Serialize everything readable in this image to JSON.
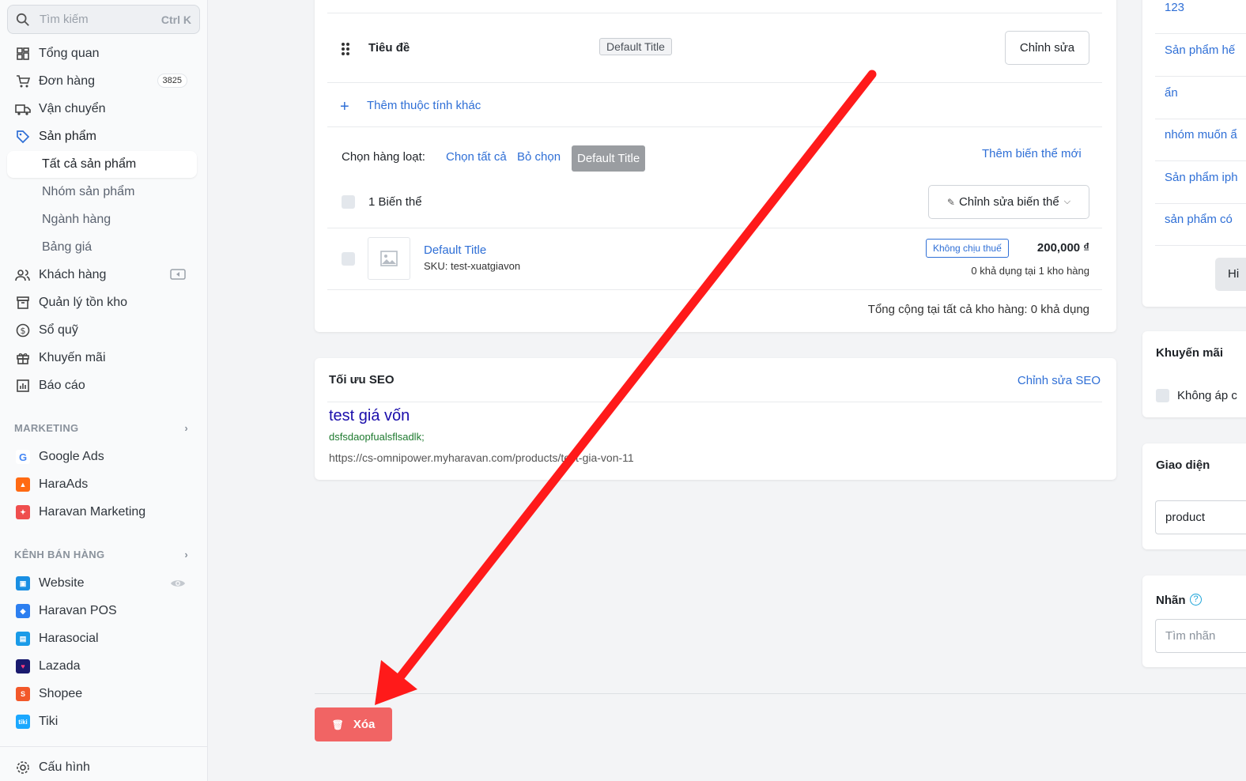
{
  "sidebar": {
    "search": {
      "placeholder": "Tìm kiếm",
      "shortcut": "Ctrl K"
    },
    "items": {
      "overview": "Tổng quan",
      "orders": "Đơn hàng",
      "orders_badge": "3825",
      "shipping": "Vận chuyển",
      "products": "Sản phẩm",
      "all_products": "Tất cả sản phẩm",
      "product_groups": "Nhóm sản phẩm",
      "categories": "Ngành hàng",
      "price_list": "Bảng giá",
      "customers": "Khách hàng",
      "inventory": "Quản lý tồn kho",
      "cashbook": "Sổ quỹ",
      "promotions": "Khuyến mãi",
      "reports": "Báo cáo"
    },
    "marketing": {
      "title": "MARKETING",
      "items": [
        "Google Ads",
        "HaraAds",
        "Haravan Marketing"
      ]
    },
    "channels": {
      "title": "KÊNH BÁN HÀNG",
      "items": [
        "Website",
        "Haravan POS",
        "Harasocial",
        "Lazada",
        "Shopee",
        "Tiki"
      ]
    },
    "settings": "Cấu hình"
  },
  "variants_card": {
    "attribute_label": "Tiêu đề",
    "attribute_value": "Default Title",
    "edit_button": "Chỉnh sửa",
    "add_attribute": "Thêm thuộc tính khác",
    "bulk_select_label": "Chọn hàng loạt:",
    "select_all": "Chọn tất cả",
    "deselect": "Bỏ chọn",
    "bulk_tag": "Default Title",
    "add_variant": "Thêm biến thể mới",
    "variant_count": "1 Biến thể",
    "edit_variants": "Chỉnh sửa biến thể",
    "variant": {
      "title": "Default Title",
      "sku": "SKU: test-xuatgiavon",
      "tax_badge": "Không chịu thuế",
      "price": "200,000 ₫",
      "availability": "0 khả dụng tại 1 kho hàng"
    },
    "total": "Tổng cộng tại tất cả kho hàng: 0 khả dụng"
  },
  "seo_card": {
    "title": "Tối ưu SEO",
    "edit_link": "Chỉnh sửa SEO",
    "seo_title": "test giá vốn",
    "seo_description": "dsfsdaopfualsflsadlk;",
    "seo_url": "https://cs-omnipower.myharavan.com/products/test-gia-von-11"
  },
  "right_panel": {
    "collections": [
      "123",
      "Sản phẩm hế",
      "ẩn",
      "nhóm muốn ẩ",
      "Sản phẩm iph",
      "sản phẩm có"
    ],
    "show_button": "Hi",
    "promo_title": "Khuyến mãi",
    "promo_checkbox": "Không áp c",
    "theme_title": "Giao diện",
    "theme_value": "product",
    "tags_title": "Nhãn",
    "tags_placeholder": "Tìm nhãn"
  },
  "delete_button": "Xóa",
  "colors": {
    "accent": "#2f6fd6",
    "danger": "#f16464",
    "arrow": "#ff1a1a"
  }
}
